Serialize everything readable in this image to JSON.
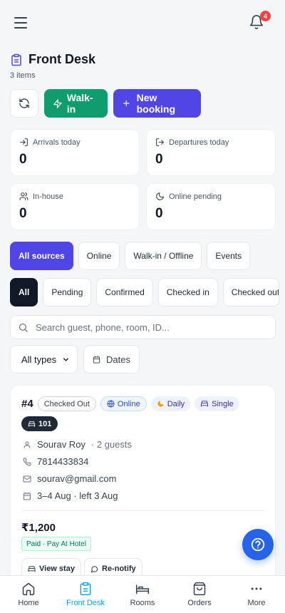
{
  "header": {
    "notifications_count": "4",
    "title": "Front Desk",
    "subtitle": "3 items"
  },
  "actions": {
    "walkin_label": "Walk-in",
    "new_booking_label": "New booking"
  },
  "stats": [
    {
      "label": "Arrivals today",
      "value": "0",
      "icon": "arrival-icon"
    },
    {
      "label": "Departures today",
      "value": "0",
      "icon": "departure-icon"
    },
    {
      "label": "In-house",
      "value": "0",
      "icon": "users-icon"
    },
    {
      "label": "Online pending",
      "value": "0",
      "icon": "moon-icon"
    }
  ],
  "source_filters": [
    "All sources",
    "Online",
    "Walk-in / Offline",
    "Events"
  ],
  "status_filters": [
    "All",
    "Pending",
    "Confirmed",
    "Checked in",
    "Checked out"
  ],
  "search": {
    "placeholder": "Search guest, phone, room, ID..."
  },
  "filters": {
    "type_selected": "All types",
    "dates_label": "Dates"
  },
  "booking": {
    "number": "#4",
    "status": "Checked Out",
    "source": "Online",
    "rate": "Daily",
    "room_type": "Single",
    "room": "101",
    "guest": "Sourav Roy",
    "guests": "· 2 guests",
    "phone": "7814433834",
    "email": "sourav@gmail.com",
    "dates": "3–4 Aug · left 3 Aug",
    "amount": "₹1,200",
    "payment": "Paid · Pay At Hotel",
    "view_label": "View stay",
    "renotify_label": "Re-notify"
  },
  "nav": [
    "Home",
    "Front Desk",
    "Rooms",
    "Orders",
    "More"
  ],
  "colors": {
    "accent": "#4f46e5",
    "walkin": "#0f9d6e",
    "active_nav": "#0ea5e9",
    "fab": "#2563eb",
    "badge": "#ef4444"
  }
}
